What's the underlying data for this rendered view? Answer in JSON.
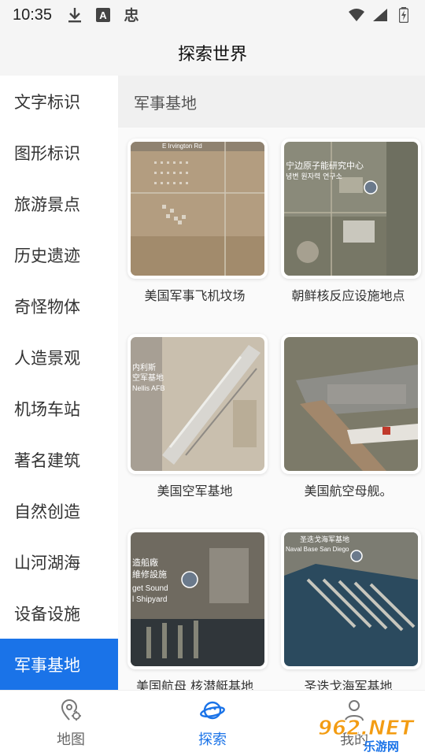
{
  "status_bar": {
    "time": "10:35",
    "left_icons": [
      "download-icon",
      "a-badge-icon",
      "bug-icon"
    ],
    "right_icons": [
      "wifi-icon",
      "signal-icon",
      "battery-icon"
    ]
  },
  "header": {
    "title": "探索世界"
  },
  "sidebar": {
    "items": [
      {
        "label": "文字标识",
        "active": false
      },
      {
        "label": "图形标识",
        "active": false
      },
      {
        "label": "旅游景点",
        "active": false
      },
      {
        "label": "历史遗迹",
        "active": false
      },
      {
        "label": "奇怪物体",
        "active": false
      },
      {
        "label": "人造景观",
        "active": false
      },
      {
        "label": "机场车站",
        "active": false
      },
      {
        "label": "著名建筑",
        "active": false
      },
      {
        "label": "自然创造",
        "active": false
      },
      {
        "label": "山河湖海",
        "active": false
      },
      {
        "label": "设备设施",
        "active": false
      },
      {
        "label": "军事基地",
        "active": true
      }
    ]
  },
  "main": {
    "section_title": "军事基地",
    "cards": [
      {
        "label": "美国军事飞机坟场",
        "map_text": [
          "E Irvington Rd"
        ]
      },
      {
        "label": "朝鲜核反应设施地点",
        "map_text": [
          "宁边原子能研究中心",
          "녕변 원자력 연구소"
        ]
      },
      {
        "label": "美国空军基地",
        "map_text": [
          "内利斯",
          "空军基地",
          "Nellis AFB"
        ]
      },
      {
        "label": "美国航空母舰。",
        "map_text": []
      },
      {
        "label": "美国航母 核潜艇基地",
        "map_text": [
          "造船廠",
          "維修設施",
          "get Sound",
          "l Shipyard"
        ]
      },
      {
        "label": "圣迭戈海军基地",
        "map_text": [
          "圣迭戈海军基地",
          "Naval Base San Diego"
        ]
      }
    ]
  },
  "bottom_nav": {
    "items": [
      {
        "label": "地图",
        "icon": "map-pin-icon",
        "active": false
      },
      {
        "label": "探索",
        "icon": "planet-icon",
        "active": true
      },
      {
        "label": "我的",
        "icon": "user-icon",
        "active": false
      }
    ]
  },
  "watermark": {
    "text": "962.NET",
    "sub": "乐游网"
  },
  "colors": {
    "accent": "#1a73e8",
    "sidebar_bg": "#ffffff",
    "page_bg": "#f5f5f5"
  }
}
